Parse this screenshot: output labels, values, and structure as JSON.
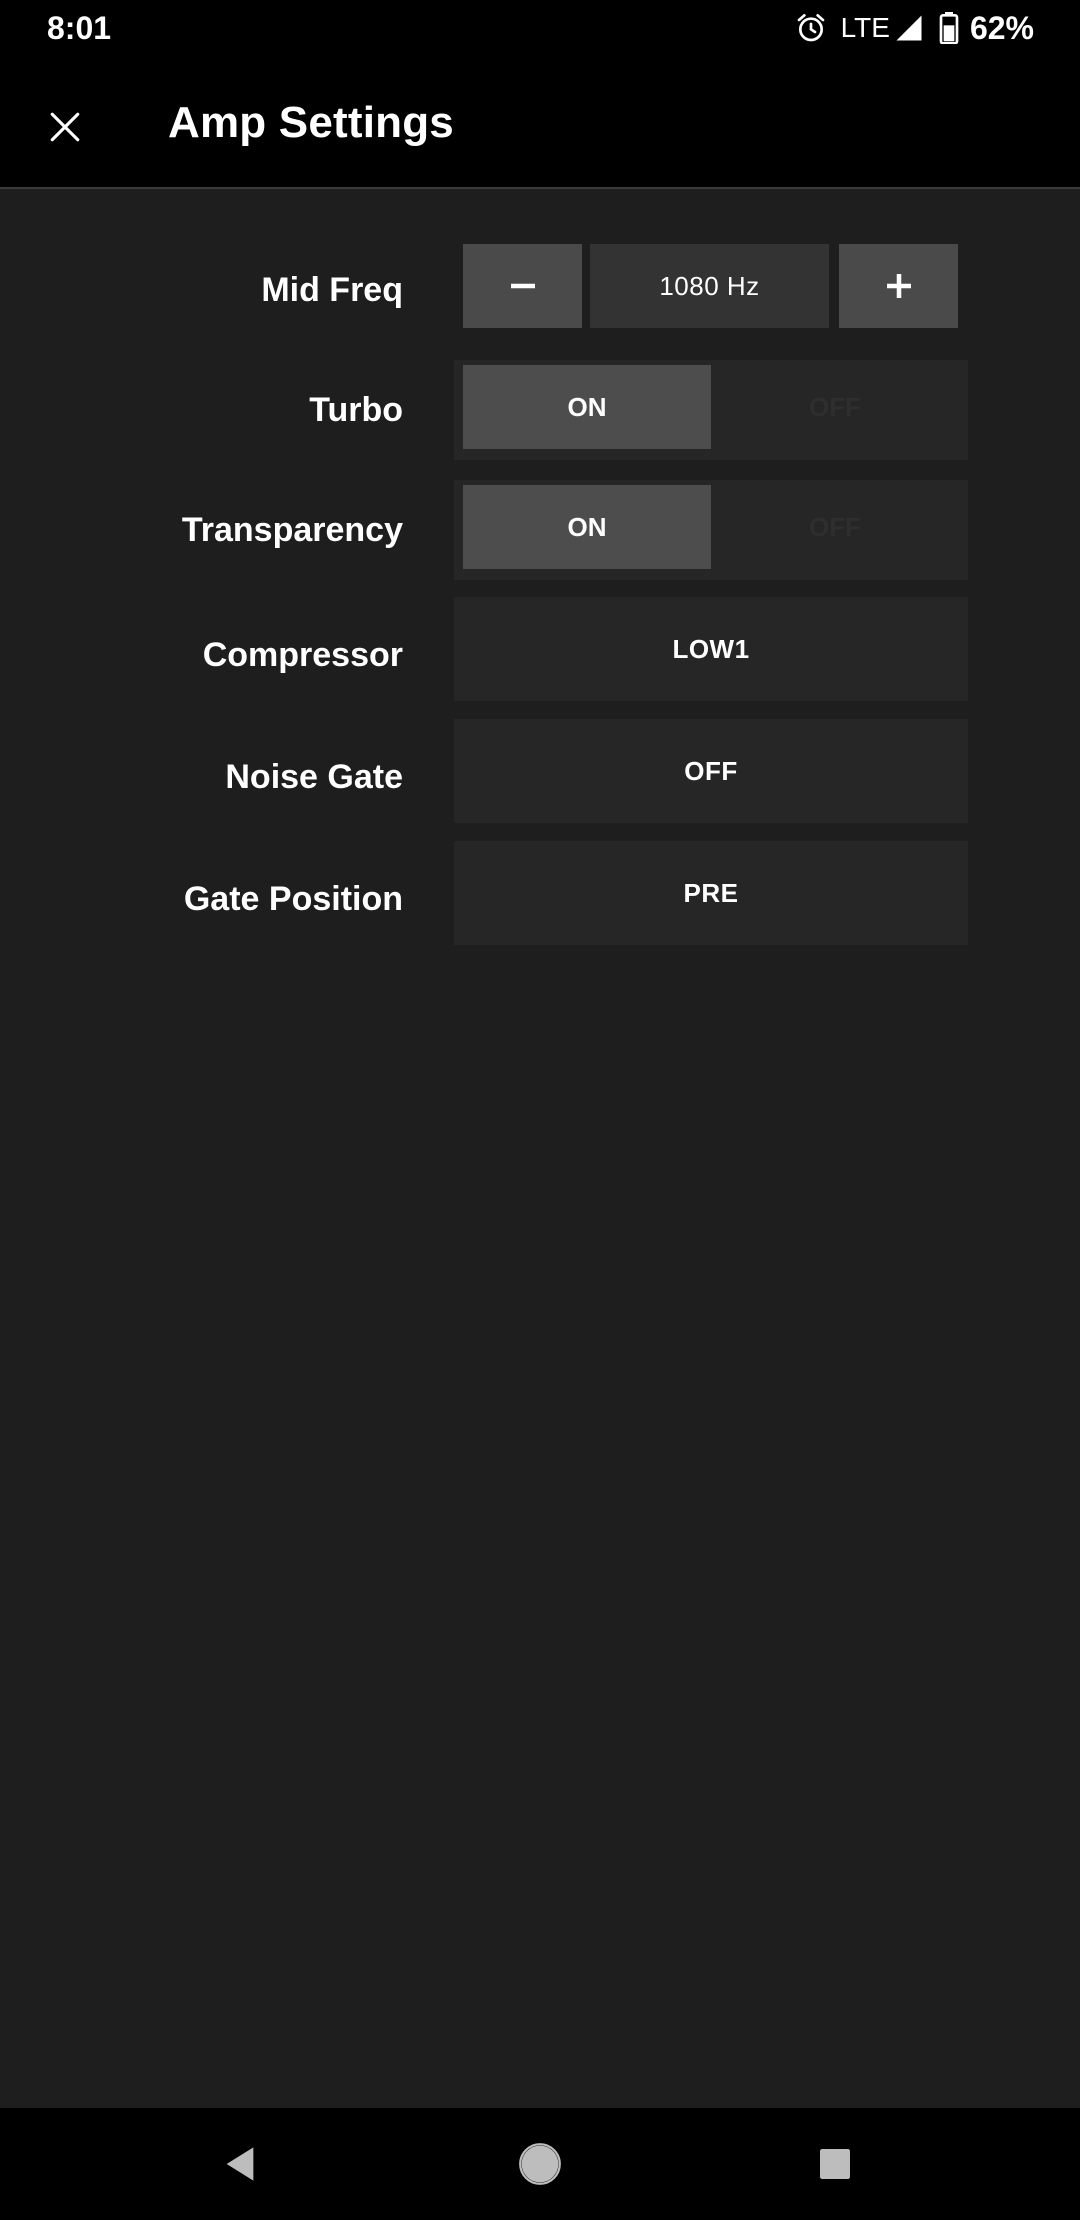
{
  "status_bar": {
    "time": "8:01",
    "network": "LTE",
    "battery": "62%",
    "icons": [
      "alarm-icon",
      "signal-icon",
      "battery-icon"
    ]
  },
  "app_bar": {
    "title": "Amp Settings",
    "close_icon": "close-icon"
  },
  "settings": {
    "mid_freq": {
      "label": "Mid Freq",
      "value": "1080 Hz",
      "decrement_icon": "minus-icon",
      "increment_icon": "plus-icon"
    },
    "turbo": {
      "label": "Turbo",
      "on_label": "ON",
      "off_label": "OFF",
      "selected": "ON"
    },
    "transparency": {
      "label": "Transparency",
      "on_label": "ON",
      "off_label": "OFF",
      "selected": "ON"
    },
    "compressor": {
      "label": "Compressor",
      "value": "LOW1"
    },
    "noise_gate": {
      "label": "Noise Gate",
      "value": "OFF"
    },
    "gate_position": {
      "label": "Gate Position",
      "value": "PRE"
    }
  },
  "nav_bar": {
    "icons": [
      "back-icon",
      "home-icon",
      "recents-icon"
    ]
  },
  "colors": {
    "background": "#1e1e1e",
    "bars": "#000000",
    "control_bg": "#262626",
    "button": "#4a4a4a",
    "text": "#ffffff"
  }
}
